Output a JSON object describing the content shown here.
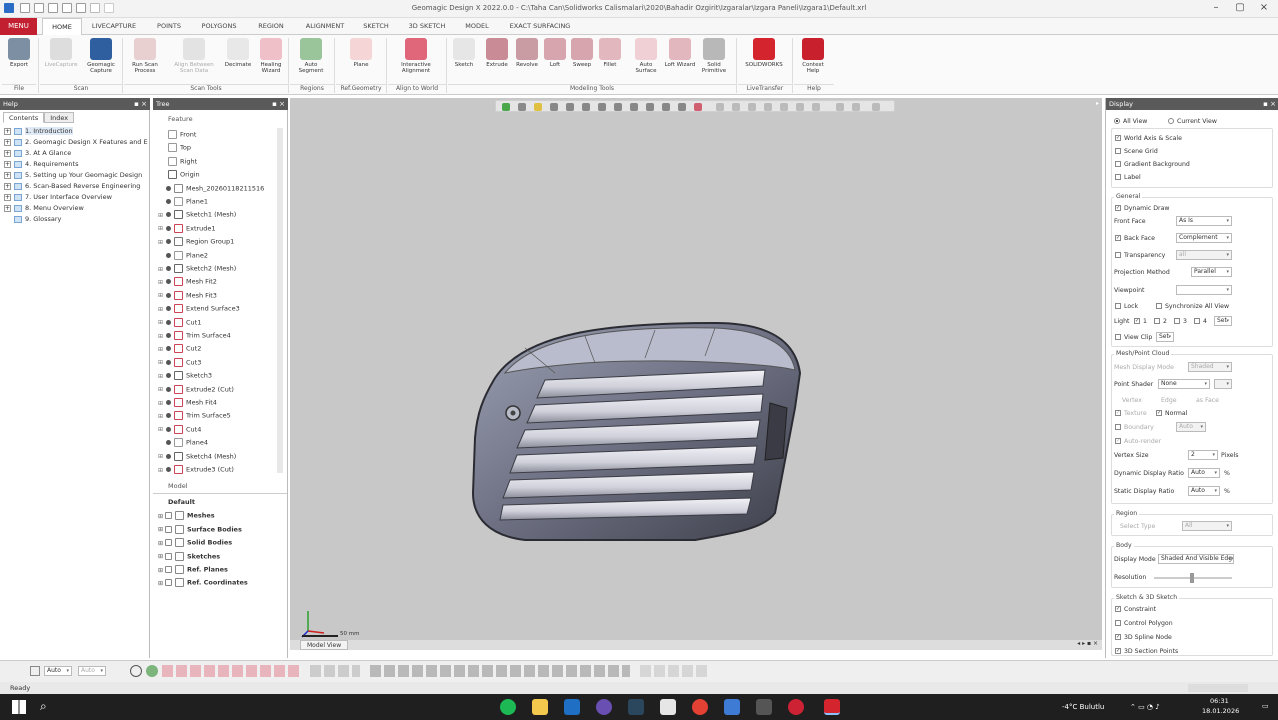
{
  "window": {
    "title": "Geomagic Design X 2022.0.0 - C:\\Taha Can\\Solidworks Calismalari\\2020\\Bahadir Ozgirit\\Izgaralar\\Izgara Paneli\\Izgara1\\Default.xrl"
  },
  "menu": {
    "menu_label": "MENU",
    "tabs": [
      "HOME",
      "LIVECAPTURE",
      "POINTS",
      "POLYGONS",
      "REGION",
      "ALIGNMENT",
      "SKETCH",
      "3D SKETCH",
      "MODEL",
      "EXACT SURFACING"
    ]
  },
  "ribbon": {
    "buttons": [
      "Export",
      "LiveCapture",
      "Geomagic Capture",
      "Run Scan Process",
      "Align Between Scan Data",
      "Decimate",
      "Healing Wizard",
      "Auto Segment",
      "Plane",
      "Interactive Alignment",
      "Sketch",
      "Extrude",
      "Revolve",
      "Loft",
      "Sweep",
      "Fillet",
      "Auto Surface",
      "Loft Wizard",
      "Solid Primitive",
      "SOLIDWORKS",
      "Context Help"
    ],
    "groups": [
      "File",
      "Scan",
      "Scan Tools",
      "Regions",
      "Ref.Geometry",
      "Align to World",
      "Modeling Tools",
      "LiveTransfer",
      "Help"
    ]
  },
  "help_panel": {
    "title": "Help",
    "tabs": [
      "Contents",
      "Index"
    ],
    "items": [
      "1. Introduction",
      "2. Geomagic Design X Features and E",
      "3. At A Glance",
      "4. Requirements",
      "5. Setting up Your Geomagic Design",
      "6. Scan-Based Reverse Engineering",
      "7. User Interface Overview",
      "8. Menu Overview",
      "9. Glossary"
    ]
  },
  "tree_panel": {
    "title": "Tree",
    "feature_header": "Feature",
    "model_header": "Model",
    "features": [
      "Front",
      "Top",
      "Right",
      "Origin",
      "Mesh_20260118211516",
      "Plane1",
      "Sketch1 (Mesh)",
      "Extrude1",
      "Region Group1",
      "Plane2",
      "Sketch2 (Mesh)",
      "Mesh Fit2",
      "Mesh Fit3",
      "Extend Surface3",
      "Cut1",
      "Trim Surface4",
      "Cut2",
      "Cut3",
      "Sketch3",
      "Extrude2 (Cut)",
      "Mesh Fit4",
      "Trim Surface5",
      "Cut4",
      "Plane4",
      "Sketch4 (Mesh)",
      "Extrude3 (Cut)"
    ],
    "model_items": [
      "Default",
      "Meshes",
      "Surface Bodies",
      "Solid Bodies",
      "Sketches",
      "Ref. Planes",
      "Ref. Coordinates"
    ]
  },
  "viewport": {
    "scale_label": "50 mm",
    "tab_label": "Model View"
  },
  "display_panel": {
    "title": "Display",
    "view_modes": [
      "All View",
      "Current View"
    ],
    "options_top": [
      "World Axis & Scale",
      "Scene Grid",
      "Gradient Background",
      "Label"
    ],
    "general_label": "General",
    "dynamic_draw": "Dynamic Draw",
    "front_face_label": "Front Face",
    "front_face_value": "As Is",
    "back_face_label": "Back Face",
    "back_face_value": "Complement",
    "transparency_label": "Transparency",
    "transparency_value": "all",
    "projection_label": "Projection Method",
    "projection_value": "Parallel",
    "viewpoint_label": "Viewpoint",
    "lock_label": "Lock",
    "sync_label": "Synchronize All View",
    "light_label": "Light",
    "light_values": [
      "1",
      "2",
      "3",
      "4"
    ],
    "set_label": "Set",
    "view_clip_label": "View Clip",
    "set2_label": "Set",
    "mesh_section_label": "Mesh/Point Cloud",
    "mesh_display_mode": "Mesh Display Mode",
    "mesh_display_value": "Shaded",
    "point_shader_label": "Point Shader",
    "point_shader_value": "None",
    "mesh_opts": [
      "Vertex",
      "Edge",
      "as Face",
      "Texture",
      "Normal",
      "Boundary",
      "Auto",
      "Auto-render"
    ],
    "vertex_size_label": "Vertex Size",
    "vertex_size_value": "2",
    "pixels_label": "Pixels",
    "dynamic_ratio_label": "Dynamic Display Ratio",
    "dynamic_ratio_value": "Auto",
    "percent": "%",
    "static_ratio_label": "Static Display Ratio",
    "static_ratio_value": "Auto",
    "region_label": "Region",
    "region_type_label": "Select Type",
    "region_type_value": "All",
    "body_label": "Body",
    "display_mode_label": "Display Mode",
    "display_mode_value": "Shaded And Visible Edge",
    "resolution_label": "Resolution",
    "sketch_section_label": "Sketch & 3D Sketch",
    "sketch_opts": [
      "Constraint",
      "Control Polygon",
      "3D Spline Node",
      "3D Section Points"
    ]
  },
  "bottom": {
    "auto1": "Auto",
    "auto2": "Auto"
  },
  "status": {
    "text": "Ready"
  },
  "taskbar": {
    "weather": "-4°C Bulutlu",
    "time": "06:31",
    "date": "18.01.2026"
  }
}
